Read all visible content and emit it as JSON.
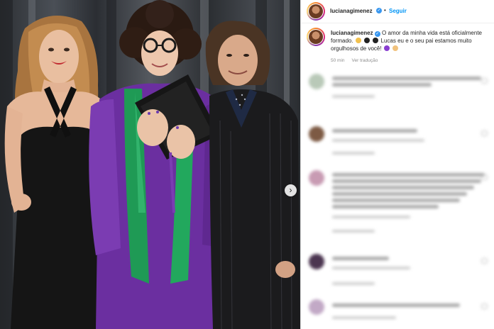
{
  "post": {
    "username": "lucianagimenez",
    "follow_label": "Seguir",
    "separator": "•",
    "verified_mark": "✓",
    "caption": "O amor da minha vida está oficialmente formado. 👏🎓 🎓 Lucas eu e o seu pai estamos muito orgulhosos de você! 💜👦",
    "caption_part1": "O amor da minha vida está oficialmente formado.",
    "caption_part2": "Lucas eu e o seu pai estamos muito orgulhosos de você!",
    "time_ago": "50 min",
    "translate_label": "Ver tradução",
    "next_icon": "chevron-right-icon",
    "next_glyph": "›"
  },
  "colors": {
    "accent": "#0095f6",
    "verified": "#3897f0",
    "gown": "#6b2fa0",
    "stole": "#1f9a55"
  }
}
